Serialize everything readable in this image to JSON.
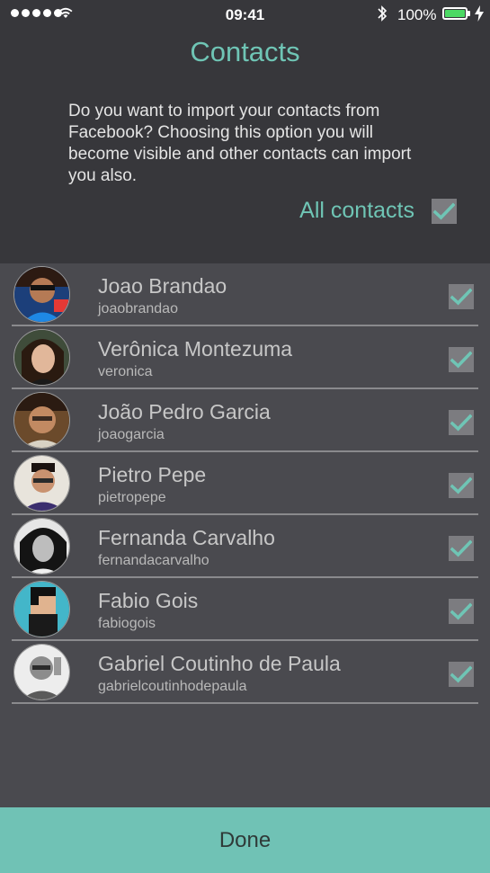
{
  "status_bar": {
    "time": "09:41",
    "battery": "100%"
  },
  "header": {
    "title": "Contacts",
    "intro": "Do you want to import your contacts from Facebook? Choosing this option you will become visible and other contacts can import you also.",
    "all_contacts_label": "All contacts",
    "all_contacts_checked": true
  },
  "contacts": [
    {
      "name": "Joao Brandao",
      "username": "joaobrandao",
      "checked": true
    },
    {
      "name": "Verônica Montezuma",
      "username": "veronica",
      "checked": true
    },
    {
      "name": "João Pedro Garcia",
      "username": "joaogarcia",
      "checked": true
    },
    {
      "name": "Pietro Pepe",
      "username": "pietropepe",
      "checked": true
    },
    {
      "name": "Fernanda Carvalho",
      "username": "fernandacarvalho",
      "checked": true
    },
    {
      "name": "Fabio Gois",
      "username": "fabiogois",
      "checked": true
    },
    {
      "name": "Gabriel Coutinho de Paula",
      "username": "gabrielcoutinhodepaula",
      "checked": true
    }
  ],
  "footer": {
    "done_label": "Done"
  },
  "colors": {
    "accent": "#6fc5b5",
    "button": "#70c2b5",
    "header_bg": "#37373b",
    "list_bg": "#4a4a4f",
    "checkbox": "#7c7c80",
    "battery": "#4cd964"
  }
}
